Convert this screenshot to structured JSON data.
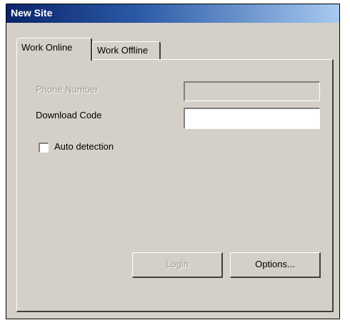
{
  "window": {
    "title": "New Site"
  },
  "tabs": [
    {
      "label": "Work Online"
    },
    {
      "label": "Work Offline"
    }
  ],
  "form": {
    "phone_number_label": "Phone Number",
    "phone_number_value": "",
    "download_code_label": "Download Code",
    "download_code_value": "",
    "auto_detection_label": "Auto detection",
    "auto_detection_checked": false
  },
  "buttons": {
    "login_label": "Login",
    "login_enabled": false,
    "options_label": "Options..."
  },
  "colors": {
    "title_start": "#0a246a",
    "title_end": "#a6caf0",
    "face": "#d4d0c8",
    "disabled_text": "#9a9891"
  }
}
